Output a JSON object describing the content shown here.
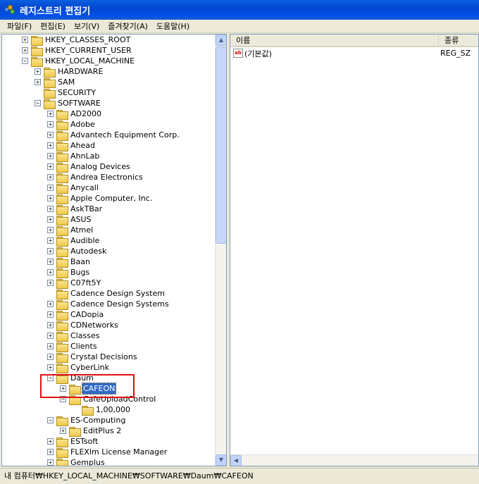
{
  "window": {
    "title": "레지스트리 편집기"
  },
  "menu": [
    "파일(F)",
    "편집(E)",
    "보기(V)",
    "즐겨찾기(A)",
    "도움말(H)"
  ],
  "tree": [
    {
      "label": "HKEY_CLASSES_ROOT",
      "level": 1,
      "exp": "+"
    },
    {
      "label": "HKEY_CURRENT_USER",
      "level": 1,
      "exp": "+"
    },
    {
      "label": "HKEY_LOCAL_MACHINE",
      "level": 1,
      "exp": "-"
    },
    {
      "label": "HARDWARE",
      "level": 2,
      "exp": "+"
    },
    {
      "label": "SAM",
      "level": 2,
      "exp": "+"
    },
    {
      "label": "SECURITY",
      "level": 2,
      "exp": ""
    },
    {
      "label": "SOFTWARE",
      "level": 2,
      "exp": "-"
    },
    {
      "label": "AD2000",
      "level": 3,
      "exp": "+"
    },
    {
      "label": "Adobe",
      "level": 3,
      "exp": "+"
    },
    {
      "label": "Advantech Equipment Corp.",
      "level": 3,
      "exp": "+"
    },
    {
      "label": "Ahead",
      "level": 3,
      "exp": "+"
    },
    {
      "label": "AhnLab",
      "level": 3,
      "exp": "+"
    },
    {
      "label": "Analog Devices",
      "level": 3,
      "exp": "+"
    },
    {
      "label": "Andrea Electronics",
      "level": 3,
      "exp": "+"
    },
    {
      "label": "Anycall",
      "level": 3,
      "exp": "+"
    },
    {
      "label": "Apple Computer, Inc.",
      "level": 3,
      "exp": "+"
    },
    {
      "label": "AskTBar",
      "level": 3,
      "exp": "+"
    },
    {
      "label": "ASUS",
      "level": 3,
      "exp": "+"
    },
    {
      "label": "Atmel",
      "level": 3,
      "exp": "+"
    },
    {
      "label": "Audible",
      "level": 3,
      "exp": "+"
    },
    {
      "label": "Autodesk",
      "level": 3,
      "exp": "+"
    },
    {
      "label": "Baan",
      "level": 3,
      "exp": "+"
    },
    {
      "label": "Bugs",
      "level": 3,
      "exp": "+"
    },
    {
      "label": "C07ft5Y",
      "level": 3,
      "exp": "+"
    },
    {
      "label": "Cadence Design System",
      "level": 3,
      "exp": ""
    },
    {
      "label": "Cadence Design Systems",
      "level": 3,
      "exp": "+"
    },
    {
      "label": "CADopia",
      "level": 3,
      "exp": "+"
    },
    {
      "label": "CDNetworks",
      "level": 3,
      "exp": "+"
    },
    {
      "label": "Classes",
      "level": 3,
      "exp": "+"
    },
    {
      "label": "Clients",
      "level": 3,
      "exp": "+"
    },
    {
      "label": "Crystal Decisions",
      "level": 3,
      "exp": "+"
    },
    {
      "label": "CyberLink",
      "level": 3,
      "exp": "+"
    },
    {
      "label": "Daum",
      "level": 3,
      "exp": "-"
    },
    {
      "label": "CAFEON",
      "level": 4,
      "exp": "+",
      "selected": true
    },
    {
      "label": "CafeUploadControl",
      "level": 4,
      "exp": "-"
    },
    {
      "label": "1,00,000",
      "level": 5,
      "exp": ""
    },
    {
      "label": "ES-Computing",
      "level": 3,
      "exp": "-"
    },
    {
      "label": "EditPlus 2",
      "level": 4,
      "exp": "+"
    },
    {
      "label": "ESTsoft",
      "level": 3,
      "exp": "+"
    },
    {
      "label": "FLEXlm License Manager",
      "level": 3,
      "exp": "+"
    },
    {
      "label": "Gemplus",
      "level": 3,
      "exp": "+"
    }
  ],
  "list": {
    "columns": [
      "이름",
      "종류"
    ],
    "rows": [
      {
        "name": "(기본값)",
        "type": "REG_SZ",
        "icon": "string-value-icon"
      }
    ]
  },
  "status": {
    "path": "내 컴퓨터₩HKEY_LOCAL_MACHINE₩SOFTWARE₩Daum₩CAFEON"
  },
  "colors": {
    "highlight_box": "#e01010",
    "selection": "#316ac5",
    "titlebar": "#0246cf"
  }
}
